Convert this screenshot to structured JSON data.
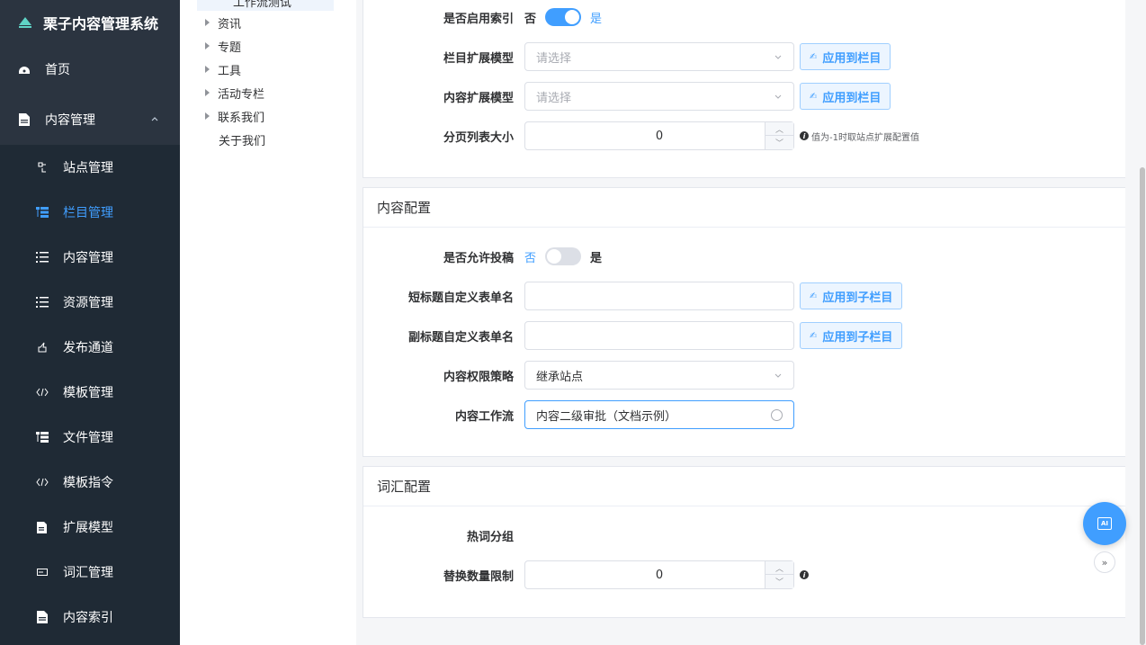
{
  "sidebar": {
    "brand": "栗子内容管理系统",
    "items": [
      {
        "label": "首页",
        "icon": "dashboard-icon"
      },
      {
        "label": "内容管理",
        "icon": "document-icon"
      }
    ],
    "subitems": [
      {
        "label": "站点管理",
        "icon": "site-icon"
      },
      {
        "label": "栏目管理",
        "icon": "catalog-icon"
      },
      {
        "label": "内容管理",
        "icon": "list-icon"
      },
      {
        "label": "资源管理",
        "icon": "list-icon"
      },
      {
        "label": "发布通道",
        "icon": "publish-icon"
      },
      {
        "label": "模板管理",
        "icon": "code-icon"
      },
      {
        "label": "文件管理",
        "icon": "tree-icon"
      },
      {
        "label": "模板指令",
        "icon": "code-icon"
      },
      {
        "label": "扩展模型",
        "icon": "edit-doc-icon"
      },
      {
        "label": "词汇管理",
        "icon": "tag-icon"
      },
      {
        "label": "内容索引",
        "icon": "document-icon"
      }
    ],
    "active_color": "#409eff"
  },
  "tree": {
    "selected": "工作流测试",
    "nodes": [
      "资讯",
      "专题",
      "工具",
      "活动专栏",
      "联系我们"
    ],
    "leaf": "关于我们"
  },
  "index_section": {
    "enable_index": {
      "label": "是否启用索引",
      "off": "否",
      "on": "是",
      "value": true
    },
    "catalog_ext_model": {
      "label": "栏目扩展模型",
      "placeholder": "请选择",
      "apply": "应用到栏目"
    },
    "content_ext_model": {
      "label": "内容扩展模型",
      "placeholder": "请选择",
      "apply": "应用到栏目"
    },
    "page_size": {
      "label": "分页列表大小",
      "value": "0",
      "tip": "值为-1时取站点扩展配置值"
    }
  },
  "content_config": {
    "title": "内容配置",
    "allow_contribute": {
      "label": "是否允许投稿",
      "off": "否",
      "on": "是",
      "value": false
    },
    "short_title_field": {
      "label": "短标题自定义表单名",
      "apply": "应用到子栏目"
    },
    "subtitle_field": {
      "label": "副标题自定义表单名",
      "apply": "应用到子栏目"
    },
    "permission_policy": {
      "label": "内容权限策略",
      "value": "继承站点"
    },
    "workflow": {
      "label": "内容工作流",
      "value": "内容二级审批（文档示例）"
    }
  },
  "vocab_config": {
    "title": "词汇配置",
    "hot_word_group": {
      "label": "热词分组"
    },
    "replace_limit": {
      "label": "替换数量限制",
      "value": "0"
    }
  },
  "fab": {
    "ai_label": "AI",
    "more": "»"
  }
}
